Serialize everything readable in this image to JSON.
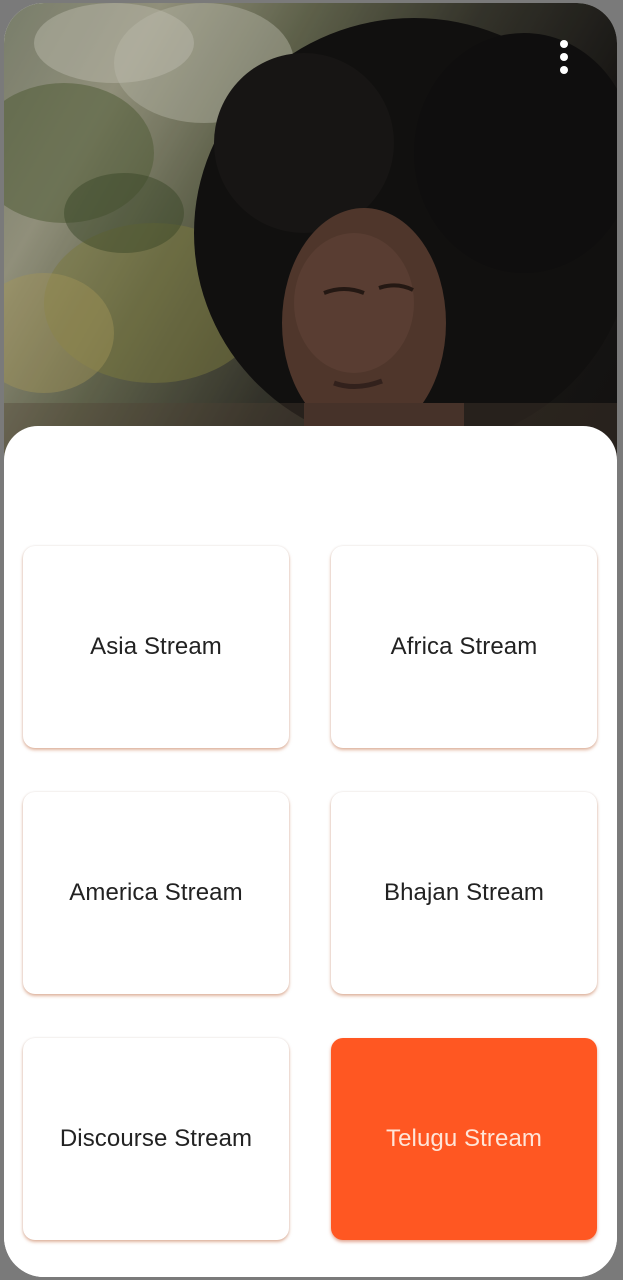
{
  "hero": {
    "menu_icon": "more-vert-icon"
  },
  "streams": [
    {
      "label": "Asia Stream",
      "active": false
    },
    {
      "label": "Africa Stream",
      "active": false
    },
    {
      "label": "America Stream",
      "active": false
    },
    {
      "label": "Bhajan Stream",
      "active": false
    },
    {
      "label": "Discourse Stream",
      "active": false
    },
    {
      "label": "Telugu Stream",
      "active": true
    }
  ],
  "colors": {
    "accent": "#ff5722",
    "card_bg": "#ffffff",
    "text": "#222222",
    "active_text": "#ffe5d8"
  }
}
